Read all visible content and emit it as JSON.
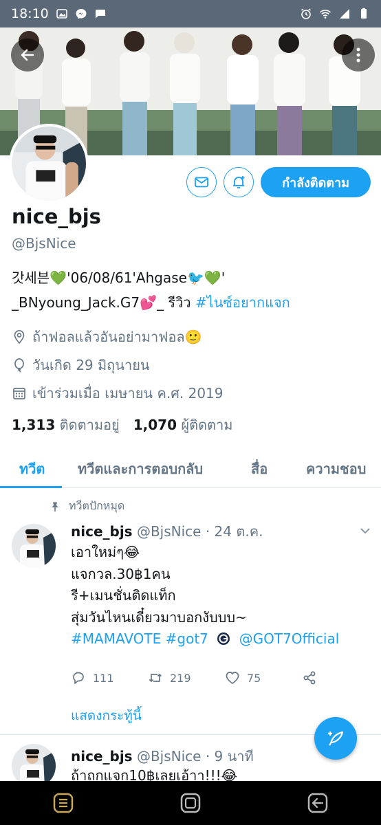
{
  "status_bar": {
    "time": "18:10"
  },
  "profile": {
    "display_name": "nice_bjs",
    "handle": "@BjsNice",
    "bio_line1": "갓세븐💚'06/08/61'Ahgase🐦💚'",
    "bio_line2_text": "_BNyoung_Jack.G7💕_ รีวิว ",
    "bio_line2_tag": "#ไนซ์อยากแจก",
    "location": "ถ้าฟอลแล้วอันอย่ามาฟอล🙂",
    "birthday": "วันเกิด 29 มิถุนายน",
    "joined": "เข้าร่วมเมื่อ เมษายน ค.ศ. 2019",
    "following_count": "1,313",
    "following_label": "ติดตามอยู่",
    "followers_count": "1,070",
    "followers_label": "ผู้ติดตาม",
    "follow_button_label": "กำลังติดตาม"
  },
  "tabs": [
    {
      "label": "ทวีต"
    },
    {
      "label": "ทวีตและการตอบกลับ"
    },
    {
      "label": "สื่อ"
    },
    {
      "label": "ความชอบ"
    }
  ],
  "tweets": [
    {
      "pinned_label": "ทวีตปักหมุด",
      "name": "nice_bjs",
      "meta": "@BjsNice · 24 ต.ค.",
      "lines": [
        "เอาใหม่ๆ😂",
        "แจกวล.30฿1คน",
        "รี+เมนชั่นติดแท็ก",
        "สุ่มวันไหนเดี๋ยวมาบอกงับบบ~"
      ],
      "link_line_tags": "#MAMAVOTE #got7",
      "link_line_mention": "@GOT7Official",
      "replies": "111",
      "retweets": "219",
      "likes": "75",
      "show_thread": "แสดงกระทู้นี้"
    },
    {
      "name": "nice_bjs",
      "meta": "@BjsNice · 9 นาที",
      "line1": "ถ้าถูกแจก10฿เลยเอ้าา!!!😂"
    }
  ],
  "colors": {
    "accent": "#1da1f2",
    "text": "#14171a",
    "muted": "#657786",
    "status_bar": "#5a6878"
  },
  "icons": [
    "back-arrow-icon",
    "more-vertical-icon",
    "mail-icon",
    "bell-plus-icon",
    "location-icon",
    "birthday-icon",
    "calendar-icon",
    "pin-icon",
    "chevron-down-icon",
    "reply-icon",
    "retweet-icon",
    "like-icon",
    "share-icon",
    "compose-icon"
  ]
}
